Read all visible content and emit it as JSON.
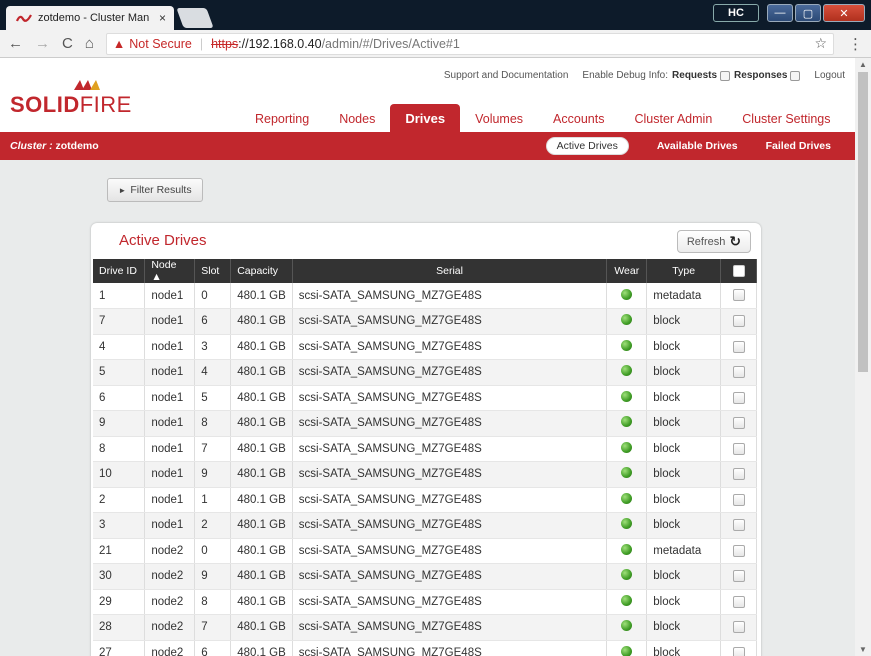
{
  "browser": {
    "tab_title": "zotdemo - Cluster Man",
    "tab_close": "×",
    "hc_label": "HC",
    "win_min": "—",
    "win_max": "▢",
    "win_close": "✕",
    "back": "←",
    "forward": "→",
    "reload": "C",
    "home": "⌂",
    "warn_icon": "▲",
    "not_secure": "Not Secure",
    "separator": "|",
    "url_scheme": "https",
    "url_host": "://192.168.0.40",
    "url_path": "/admin/#/Drives/Active#1",
    "star": "☆",
    "menu": "⋮",
    "favicon_color": "#c1272d"
  },
  "header": {
    "logo_solid": "SOLID",
    "logo_fire": "FIRE",
    "support_link": "Support and Documentation",
    "debug_label": "Enable Debug Info:",
    "requests_label": "Requests",
    "responses_label": "Responses",
    "logout_link": "Logout"
  },
  "nav": {
    "tabs": [
      "Reporting",
      "Nodes",
      "Drives",
      "Volumes",
      "Accounts",
      "Cluster Admin",
      "Cluster Settings"
    ],
    "active": "Drives"
  },
  "cluster_bar": {
    "label": "Cluster : ",
    "name": "zotdemo",
    "subtabs": [
      "Active Drives",
      "Available Drives",
      "Failed Drives"
    ],
    "active_subtab": "Active Drives"
  },
  "filter": {
    "arrow": "►",
    "label": "Filter Results"
  },
  "panel": {
    "title": "Active Drives",
    "refresh_label": "Refresh",
    "refresh_icon": "↻"
  },
  "table": {
    "columns": [
      "Drive ID",
      "Node ▲",
      "Slot",
      "Capacity",
      "Serial",
      "Wear",
      "Type"
    ],
    "rows": [
      {
        "id": "1",
        "node": "node1",
        "slot": "0",
        "capacity": "480.1 GB",
        "serial": "scsi-SATA_SAMSUNG_MZ7GE48S",
        "type": "metadata"
      },
      {
        "id": "7",
        "node": "node1",
        "slot": "6",
        "capacity": "480.1 GB",
        "serial": "scsi-SATA_SAMSUNG_MZ7GE48S",
        "type": "block"
      },
      {
        "id": "4",
        "node": "node1",
        "slot": "3",
        "capacity": "480.1 GB",
        "serial": "scsi-SATA_SAMSUNG_MZ7GE48S",
        "type": "block"
      },
      {
        "id": "5",
        "node": "node1",
        "slot": "4",
        "capacity": "480.1 GB",
        "serial": "scsi-SATA_SAMSUNG_MZ7GE48S",
        "type": "block"
      },
      {
        "id": "6",
        "node": "node1",
        "slot": "5",
        "capacity": "480.1 GB",
        "serial": "scsi-SATA_SAMSUNG_MZ7GE48S",
        "type": "block"
      },
      {
        "id": "9",
        "node": "node1",
        "slot": "8",
        "capacity": "480.1 GB",
        "serial": "scsi-SATA_SAMSUNG_MZ7GE48S",
        "type": "block"
      },
      {
        "id": "8",
        "node": "node1",
        "slot": "7",
        "capacity": "480.1 GB",
        "serial": "scsi-SATA_SAMSUNG_MZ7GE48S",
        "type": "block"
      },
      {
        "id": "10",
        "node": "node1",
        "slot": "9",
        "capacity": "480.1 GB",
        "serial": "scsi-SATA_SAMSUNG_MZ7GE48S",
        "type": "block"
      },
      {
        "id": "2",
        "node": "node1",
        "slot": "1",
        "capacity": "480.1 GB",
        "serial": "scsi-SATA_SAMSUNG_MZ7GE48S",
        "type": "block"
      },
      {
        "id": "3",
        "node": "node1",
        "slot": "2",
        "capacity": "480.1 GB",
        "serial": "scsi-SATA_SAMSUNG_MZ7GE48S",
        "type": "block"
      },
      {
        "id": "21",
        "node": "node2",
        "slot": "0",
        "capacity": "480.1 GB",
        "serial": "scsi-SATA_SAMSUNG_MZ7GE48S",
        "type": "metadata"
      },
      {
        "id": "30",
        "node": "node2",
        "slot": "9",
        "capacity": "480.1 GB",
        "serial": "scsi-SATA_SAMSUNG_MZ7GE48S",
        "type": "block"
      },
      {
        "id": "29",
        "node": "node2",
        "slot": "8",
        "capacity": "480.1 GB",
        "serial": "scsi-SATA_SAMSUNG_MZ7GE48S",
        "type": "block"
      },
      {
        "id": "28",
        "node": "node2",
        "slot": "7",
        "capacity": "480.1 GB",
        "serial": "scsi-SATA_SAMSUNG_MZ7GE48S",
        "type": "block"
      },
      {
        "id": "27",
        "node": "node2",
        "slot": "6",
        "capacity": "480.1 GB",
        "serial": "scsi-SATA_SAMSUNG_MZ7GE48S",
        "type": "block"
      }
    ]
  },
  "colors": {
    "brand_red": "#c1272d",
    "header_dark": "#333333",
    "wear_green": "#3f9c25"
  }
}
